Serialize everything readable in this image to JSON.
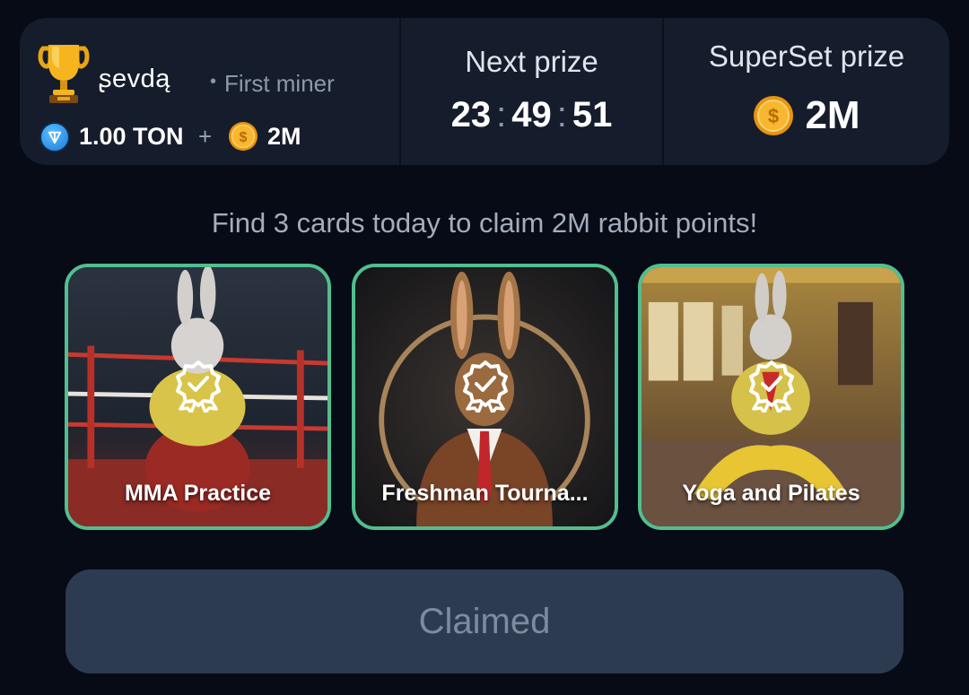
{
  "top_panel": {
    "miner": {
      "name": "ʂevdą",
      "separator": "•",
      "rank": "First miner",
      "reward_ton": "1.00 TON",
      "reward_plus": "+",
      "reward_coins": "2M"
    },
    "next_prize": {
      "title": "Next prize",
      "hours": "23",
      "minutes": "49",
      "seconds": "51",
      "separator": ":"
    },
    "superset_prize": {
      "title": "SuperSet prize",
      "amount": "2M"
    }
  },
  "hint": "Find 3 cards today to claim 2M rabbit points!",
  "cards": [
    {
      "label": "MMA Practice",
      "status_icon": "certified-badge-icon"
    },
    {
      "label": "Freshman Tourna...",
      "status_icon": "certified-badge-icon"
    },
    {
      "label": "Yoga and Pilates",
      "status_icon": "certified-badge-icon"
    }
  ],
  "claim_button": {
    "label": "Claimed"
  },
  "colors": {
    "background": "#060b16",
    "panel": "#151d2c",
    "card_border": "#52be8f",
    "button_bg": "#2d3b51",
    "button_text": "#7d8a9f",
    "coin": "#f5a623",
    "ton": "#2f9bf0"
  }
}
